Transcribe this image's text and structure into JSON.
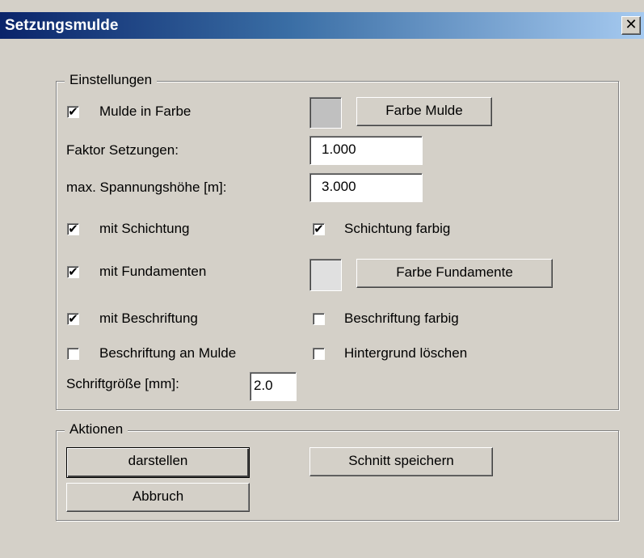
{
  "window": {
    "title": "Setzungsmulde",
    "close_symbol": "✕"
  },
  "settings": {
    "legend": "Einstellungen",
    "mulde_in_farbe": {
      "label": "Mulde in Farbe",
      "checked": true
    },
    "farbe_mulde_button": "Farbe Mulde",
    "mulde_color": "#c0c0c0",
    "faktor_setzungen": {
      "label": "Faktor Setzungen:",
      "value": "1.000"
    },
    "max_spannungshoehe": {
      "label": "max. Spannungshöhe [m]:",
      "value": "3.000"
    },
    "mit_schichtung": {
      "label": "mit Schichtung",
      "checked": true
    },
    "schichtung_farbig": {
      "label": "Schichtung farbig",
      "checked": true
    },
    "mit_fundamenten": {
      "label": "mit Fundamenten",
      "checked": true
    },
    "farbe_fundamente_button": "Farbe Fundamente",
    "fundamente_color": "#e0e0e0",
    "mit_beschriftung": {
      "label": "mit Beschriftung",
      "checked": true
    },
    "beschriftung_farbig": {
      "label": "Beschriftung farbig",
      "checked": false
    },
    "beschriftung_an_mulde": {
      "label": "Beschriftung an Mulde",
      "checked": false
    },
    "hintergrund_loeschen": {
      "label": "Hintergrund löschen",
      "checked": false
    },
    "schriftgroesse": {
      "label": "Schriftgröße [mm]:",
      "value": "2.0"
    }
  },
  "actions": {
    "legend": "Aktionen",
    "darstellen": "darstellen",
    "schnitt_speichern": "Schnitt speichern",
    "abbruch": "Abbruch"
  },
  "check_symbol": "✔"
}
